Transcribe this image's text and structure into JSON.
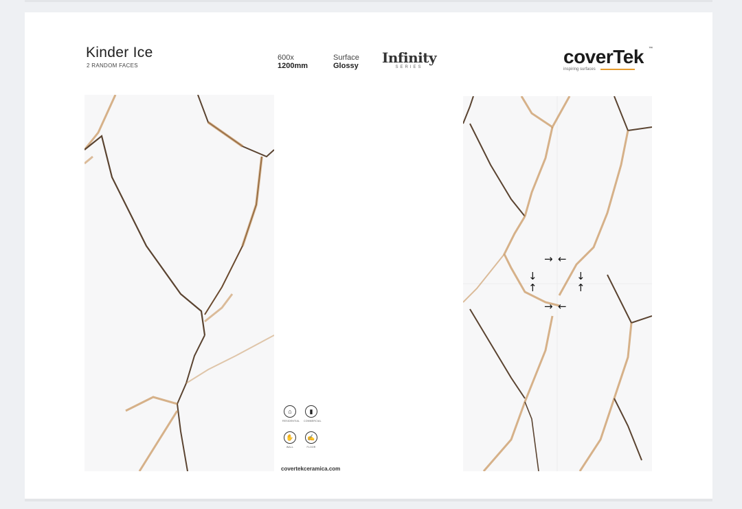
{
  "product": {
    "name": "Kinder Ice",
    "faces": "2 RANDOM FACES"
  },
  "specs": {
    "size_label": "600x",
    "size_value": "1200mm",
    "surface_label": "Surface",
    "surface_value": "Glossy"
  },
  "series": {
    "name": "Infinity",
    "sub": "SERIES"
  },
  "brand": {
    "name": "coverTek",
    "tagline": "inspiring surfaces",
    "tm": "™",
    "accent": "#e49a2c"
  },
  "usage_icons": [
    {
      "icon": "residential-icon",
      "glyph": "⌂",
      "caption": "RESIDENTIAL"
    },
    {
      "icon": "commercial-icon",
      "glyph": "▮",
      "caption": "COMMERCIAL"
    },
    {
      "icon": "wall-icon",
      "glyph": "✋",
      "caption": "WALL"
    },
    {
      "icon": "floor-icon",
      "glyph": "✍",
      "caption": "FLOOR"
    }
  ],
  "website": "covertekceramica.com",
  "layout_arrows": {
    "right": "→",
    "left": "←",
    "down": "↓",
    "up": "↑"
  },
  "colors": {
    "vein_dark": "#5a4330",
    "vein_gold": "#c8935a",
    "marble": "#f7f7f8"
  }
}
